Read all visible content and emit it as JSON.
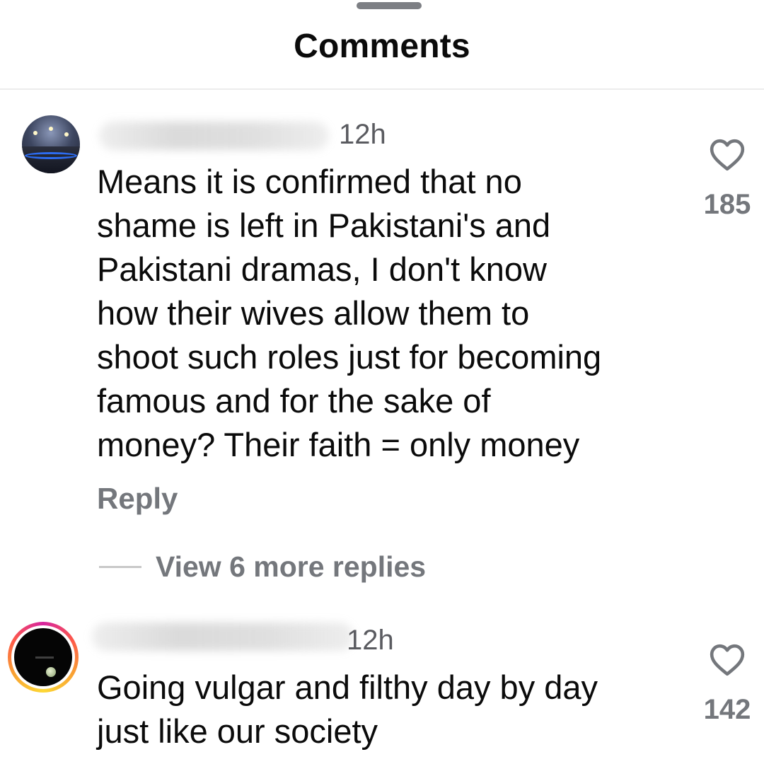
{
  "sheet": {
    "title": "Comments"
  },
  "comments": [
    {
      "time": "12h",
      "text_lines": [
        "Means it is confirmed that no",
        "shame is left in Pakistani's and",
        "Pakistani dramas, I don't know",
        "how their wives allow them to",
        "shoot such roles just for becoming",
        "famous and for the sake of",
        "money? Their faith = only money"
      ],
      "like_count": "185",
      "reply_label": "Reply",
      "view_replies_label": "View 6 more replies"
    },
    {
      "time": "12h",
      "text_lines": [
        "Going vulgar and filthy day by day",
        "just like our society"
      ],
      "like_count": "142"
    }
  ],
  "icons": {
    "like": "heart-outline-icon"
  },
  "colors": {
    "text": "#0b0b0b",
    "secondary": "#74777c",
    "story_ring": [
      "#d6249f",
      "#fd5949",
      "#f9a233",
      "#fdd835"
    ]
  }
}
